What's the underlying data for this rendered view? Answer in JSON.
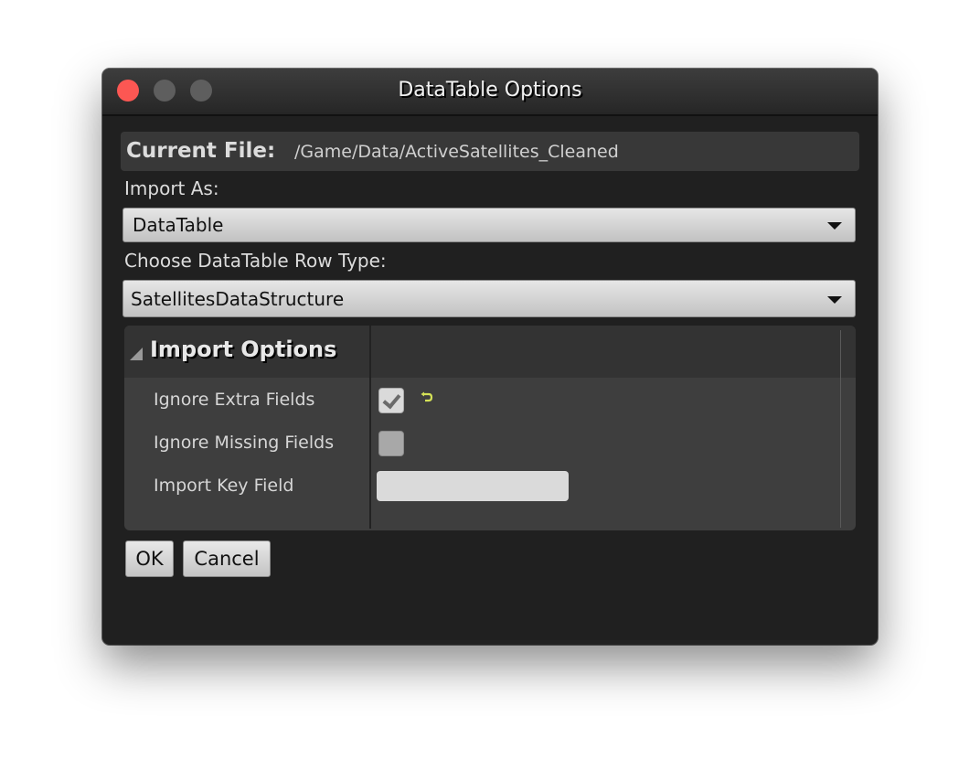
{
  "window": {
    "title": "DataTable Options",
    "controls": [
      "close",
      "minimize",
      "maximize"
    ]
  },
  "current_file": {
    "label": "Current File:",
    "value": "/Game/Data/ActiveSatellites_Cleaned"
  },
  "import_as": {
    "label": "Import As:",
    "selected": "DataTable"
  },
  "row_type": {
    "label": "Choose DataTable Row Type:",
    "selected": "SatellitesDataStructure"
  },
  "import_options": {
    "title": "Import Options",
    "expanded": true,
    "properties": [
      {
        "label": "Ignore Extra Fields",
        "type": "checkbox",
        "checked": true,
        "reset_to_default": true
      },
      {
        "label": "Ignore Missing Fields",
        "type": "checkbox",
        "checked": false
      },
      {
        "label": "Import Key Field",
        "type": "text",
        "value": ""
      }
    ]
  },
  "buttons": {
    "ok": "OK",
    "cancel": "Cancel"
  },
  "colors": {
    "close_button": "#fc5753",
    "reset_icon": "#d4e157",
    "window_bg": "#202020"
  }
}
